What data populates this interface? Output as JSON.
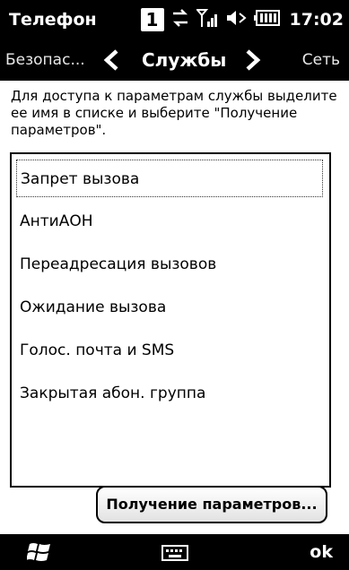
{
  "status_bar": {
    "title": "Телефон",
    "notification_badge": "1",
    "time": "17:02",
    "icons": [
      "notification-badge-icon",
      "data-connection-icon",
      "signal-icon",
      "volume-icon",
      "battery-icon"
    ]
  },
  "pivot": {
    "prev": "Безопас...",
    "current": "Службы",
    "next": "Сеть"
  },
  "content": {
    "hint": "Для доступа к параметрам службы выделите ее имя в списке и выберите \"Получение параметров\".",
    "items": [
      {
        "label": "Запрет вызова",
        "selected": true
      },
      {
        "label": "АнтиАОН",
        "selected": false
      },
      {
        "label": "Переадресация вызовов",
        "selected": false
      },
      {
        "label": "Ожидание вызова",
        "selected": false
      },
      {
        "label": "Голос. почта и SMS",
        "selected": false
      },
      {
        "label": "Закрытая абон. группа",
        "selected": false
      }
    ],
    "button_label": "Получение параметров..."
  },
  "soft_keys": {
    "right": "ok",
    "icons": [
      "windows-start-icon",
      "keyboard-icon"
    ]
  }
}
